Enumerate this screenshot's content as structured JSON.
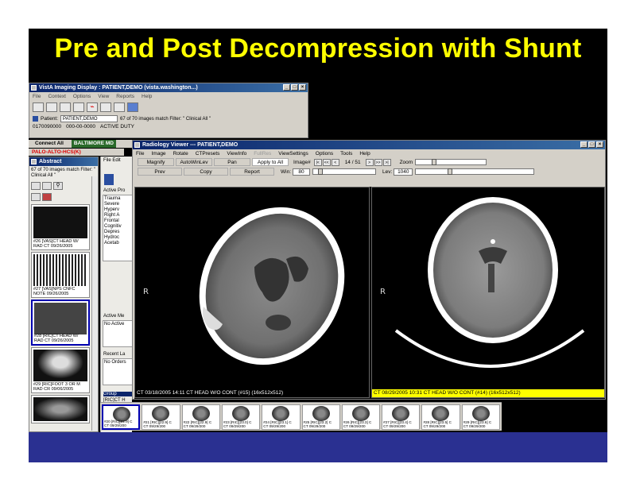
{
  "slide": {
    "title": "Pre and Post Decompression with Shunt"
  },
  "vista": {
    "title": "VistA Imaging Display : PATIENT,DEMO (vista.washington...)",
    "menu": [
      "File",
      "Context",
      "Options",
      "View",
      "Reports",
      "Help"
    ],
    "patient_label": "Patient:",
    "patient_value": "PATIENT,DEMO",
    "filter_text": "67 of 70 images match Filter: \" Clinical All \"",
    "id_number": "0170090000",
    "ssn": "000-00-0000",
    "status": "ACTIVE DUTY"
  },
  "connect": {
    "connect_all": "Connect All",
    "site1": "BALTIMORE MD",
    "site2": "PALO-ALTO-HCS(K)"
  },
  "abstract": {
    "title": "Abstract",
    "header": "67 of 70 images match Filter: \" Clinical All \"",
    "thumbs": [
      "#26 [VAS]CT HEAD W/\nRAD CT 09/26/2005",
      "#27 [VAS]NPS CNFC\nNOTE 09/26/2005",
      "#28 [RIC]CT HEAD W/\nRAD CT 09/26/2005",
      "#29 [RIC]FOOT 3 OR M\nRAD CR 09/06/2005"
    ]
  },
  "midpanel": {
    "tabs": "File  Edit",
    "active_problems_label": "Active Pro",
    "problems": [
      "Trauma",
      "Severe",
      "Hyperv",
      "Right A",
      "Frontal",
      "Cognitiv",
      "Depres",
      "Hydroc",
      "Acetab"
    ],
    "active_meds_label": "Active Me",
    "meds_value": "No Active",
    "recent_labs_label": "Recent La",
    "labs_value": "No Orders",
    "group_label": "Group",
    "group_value": "[RIC]CT H"
  },
  "strip": {
    "thumbs": [
      "#20 [RIC][22.9] C\nCT 09/29/200",
      "#21 [RIC][22.9] C\nCT 09/29/200",
      "#22 [RIC][22.9] C\nCT 09/29/200",
      "#23 [RIC][23.0] C\nCT 09/29/200",
      "#24 [RIC][23.1] C\nCT 09/29/200",
      "#25 [RIC][23.2] C\nCT 09/29/200",
      "#26 [RIC][23.3] C\nCT 09/29/200",
      "#27 [RIC][23.4] C\nCT 09/29/200",
      "#28 [RIC][23.5] C\nCT 09/29/200",
      "#29 [RIC][23.6] C\nCT 09/29/200"
    ]
  },
  "viewer": {
    "title": "Radiology Viewer --- PATIENT,DEMO",
    "menu": [
      "File",
      "Image",
      "Rotate",
      "CTPresets",
      "ViewInfo",
      "FullRes",
      "ViewSettings",
      "Options",
      "Tools",
      "Help"
    ],
    "row1": {
      "magnify": "Magnify",
      "autowinlev": "AutoWinLev",
      "pan": "Pan",
      "apply_all": "Apply to All",
      "imagenum_label": "Image#",
      "nav_first": "|<",
      "nav_prev2": "<<",
      "nav_prev": "<",
      "image_position": "14 / 51",
      "nav_next": ">",
      "nav_next2": ">>",
      "nav_last": ">|",
      "zoom_label": "Zoom"
    },
    "row2": {
      "prev": "Prev",
      "copy": "Copy",
      "report": "Report",
      "win_label": "Win:",
      "win_value": "80",
      "lev_label": "Lev:",
      "lev_value": "1040"
    },
    "left_caption": "CT 03/18/2005 14:11 CT HEAD W/O CONT (#15) (16x512x512)",
    "right_caption": "CT 08/29/2005 10:31 CT HEAD W/O CONT (#14) (16x512x512)",
    "orientation_mark": "R"
  },
  "colors": {
    "title_yellow": "#ffff00",
    "slide_bg": "#000000",
    "bottom_bar": "#2a3091",
    "right_caption_bg": "#ffff00"
  }
}
